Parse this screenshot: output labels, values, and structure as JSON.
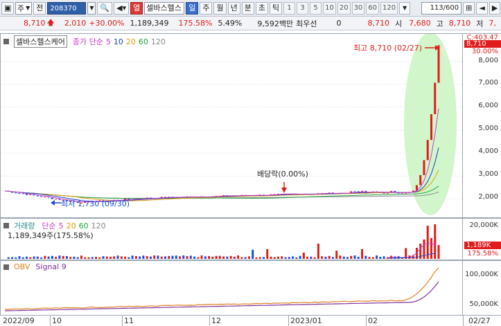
{
  "toolbar": {
    "market": "주",
    "prev_label": "전",
    "code": "208370",
    "name": "셀바스헬스",
    "tag_hot": "열",
    "periods": [
      "일",
      "주",
      "월",
      "년",
      "분",
      "초",
      "틱"
    ],
    "intervals": [
      "1",
      "3",
      "5",
      "10",
      "20",
      "30",
      "60",
      "120"
    ],
    "page": "113/600"
  },
  "quote": {
    "price": "8,710",
    "change": "2,010",
    "change_pct": "+30.00%",
    "volume": "1,189,349",
    "volume_ratio": "175.58%",
    "turnover_pct": "5.49%",
    "amount": "9,592백만",
    "priority_label": "최우선",
    "priority_value": "0",
    "last": "8,710",
    "open_label": "시",
    "open": "7,680",
    "high_label": "고",
    "high": "8,710",
    "low_label": "저",
    "low": "7,"
  },
  "price_panel": {
    "name_label": "셀바스헬스케어",
    "ma_label": "종가 단순",
    "ma_periods": [
      "5",
      "10",
      "20",
      "60",
      "120"
    ],
    "high_annotation": "최고 8,710 (02/27)",
    "low_annotation": "최저 1,730 (09/30)",
    "dividend_annotation": "배당락(0.00%)",
    "top_axis_label": "C:403.47",
    "current_badge": "8,710",
    "pct_badge": "30.00%",
    "yticks": [
      "8,000",
      "7,000",
      "6,000",
      "5,000",
      "4,000",
      "3,000",
      "2,000"
    ]
  },
  "volume_panel": {
    "label": "거래량",
    "ma_label": "단순",
    "ma_periods": [
      "5",
      "20",
      "60",
      "120"
    ],
    "value_text": "1,189,349주(175.58%)",
    "badge": "1,189K",
    "pct_badge": "175.58%",
    "yticks": [
      "20,000K",
      "10,000K"
    ]
  },
  "obv_panel": {
    "label": "OBV",
    "signal_label": "Signal 9",
    "yticks": [
      "100,000K",
      "50,000K"
    ]
  },
  "xaxis": {
    "labels": [
      "2022/09",
      "10",
      "11",
      "12",
      "2023/01",
      "02"
    ],
    "right_label": "02/27"
  },
  "colors": {
    "up": "#e01c1c",
    "down": "#1c4fd8",
    "ma5": "#c83cc8",
    "ma10": "#2040c0",
    "ma20": "#e0a000",
    "ma60": "#20a040",
    "ma120": "#808080",
    "highlight": "#c8f4c0"
  },
  "chart_data": {
    "type": "line",
    "title": "셀바스헬스케어",
    "xlabel": "",
    "ylabel": "",
    "ylim": [
      1500,
      8900
    ],
    "x": [
      "2022/09",
      "10",
      "11",
      "12",
      "2023/01",
      "02",
      "02/27"
    ],
    "series": [
      {
        "name": "종가",
        "values": [
          2300,
          1900,
          2050,
          2100,
          2150,
          2300,
          8710
        ]
      }
    ]
  }
}
